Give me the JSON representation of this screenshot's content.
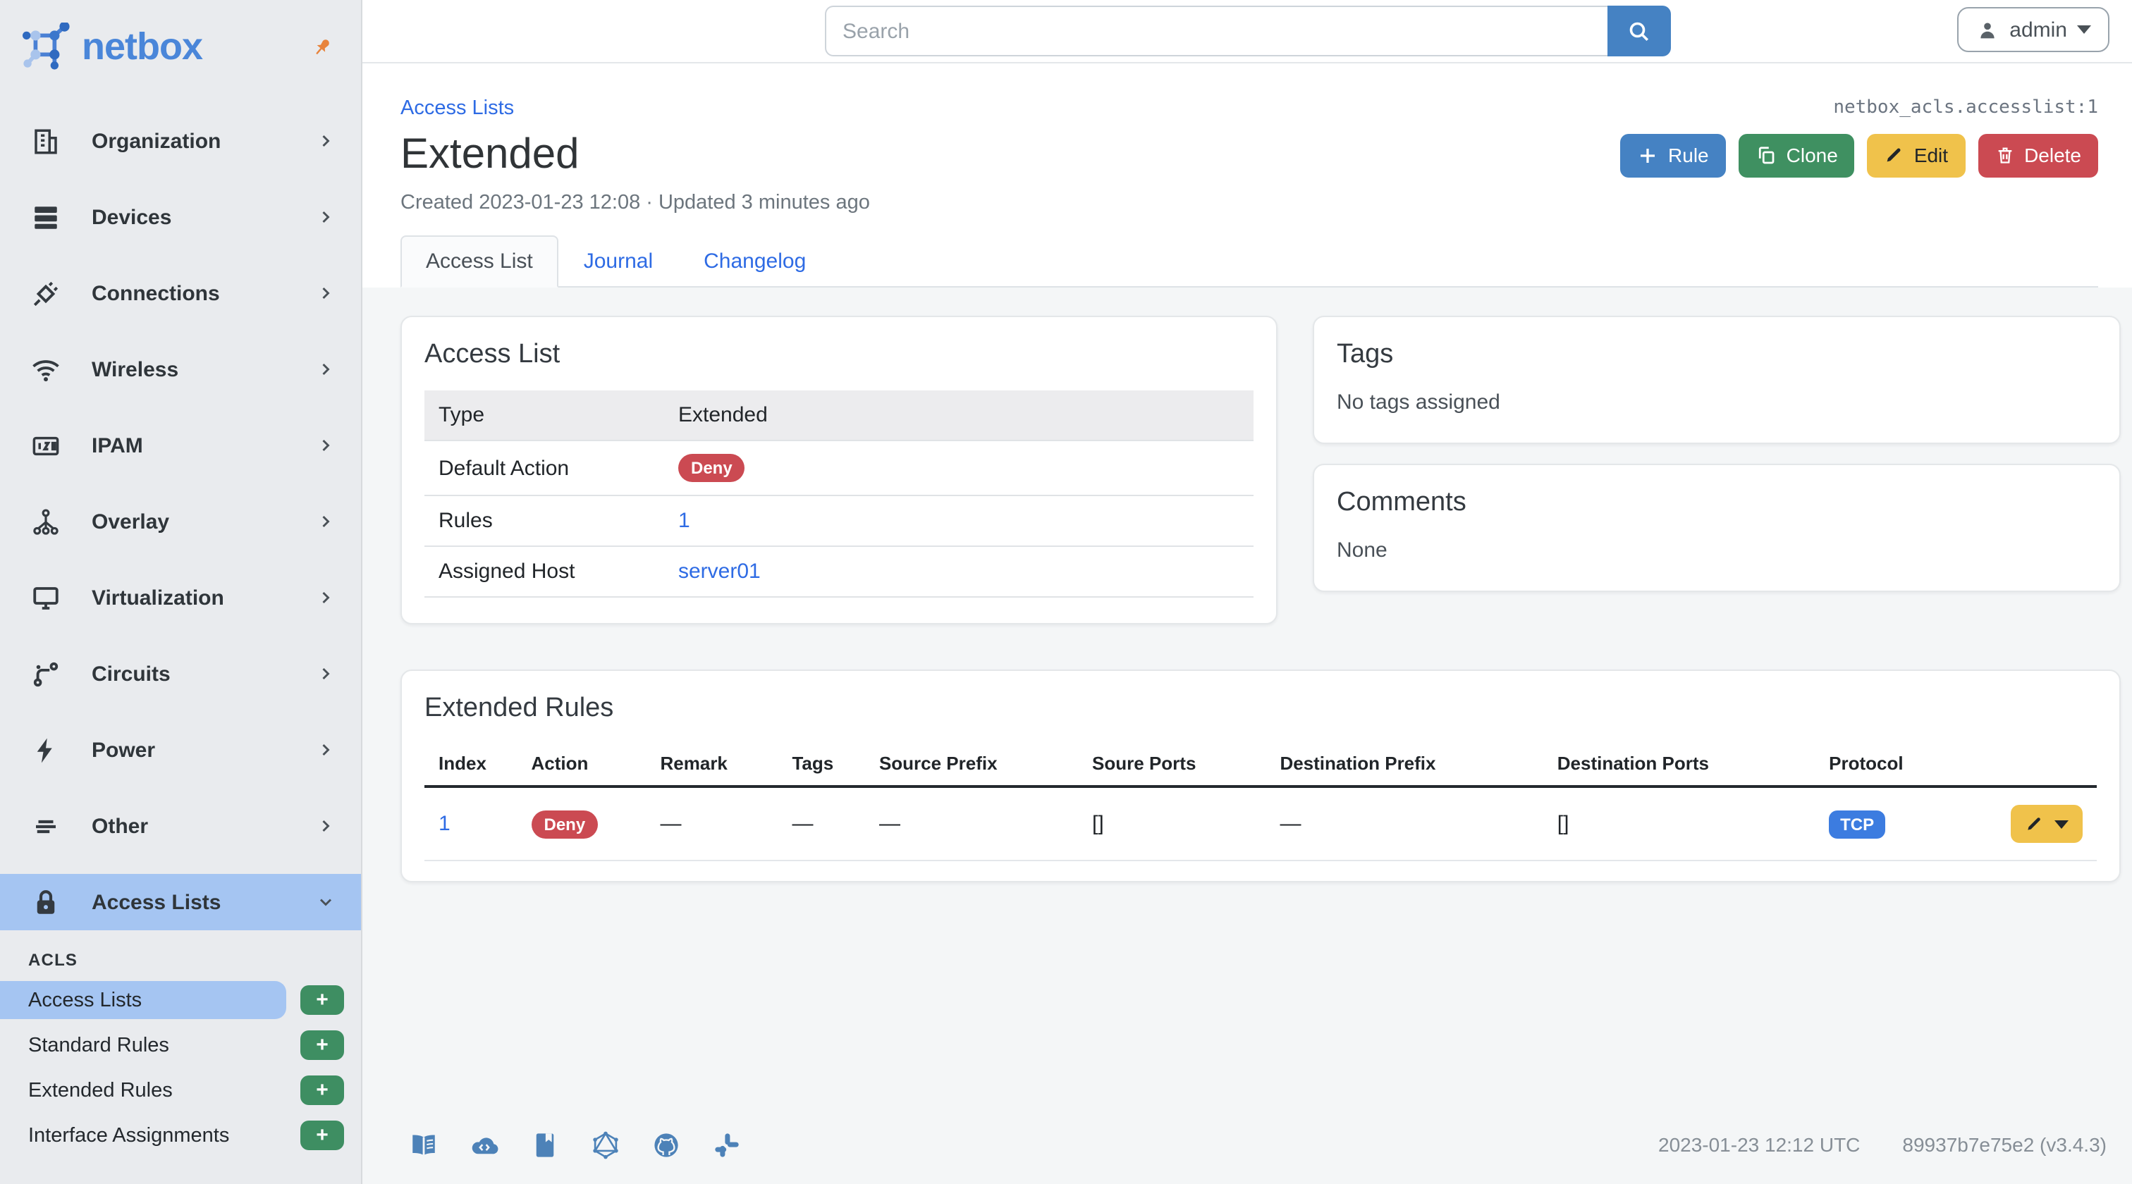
{
  "colors": {
    "primary_blue": "#4582c3",
    "link_blue": "#2e6be4",
    "nav_active_blue": "#a5c5f2",
    "green": "#3e8e62",
    "yellow": "#f0c24b",
    "red": "#cb4a52",
    "protocol_badge_blue": "#3c7ce0",
    "footer_icon_blue": "#4d82b8",
    "pin_orange": "#e8843c",
    "sidebar_bg": "#e9ebee",
    "content_bg": "#f4f6f7"
  },
  "sidebar": {
    "logo_text": "netbox",
    "items": [
      {
        "label": "Organization"
      },
      {
        "label": "Devices"
      },
      {
        "label": "Connections"
      },
      {
        "label": "Wireless"
      },
      {
        "label": "IPAM"
      },
      {
        "label": "Overlay"
      },
      {
        "label": "Virtualization"
      },
      {
        "label": "Circuits"
      },
      {
        "label": "Power"
      },
      {
        "label": "Other"
      },
      {
        "label": "Access Lists"
      }
    ],
    "acls_heading": "ACLS",
    "acls_items": [
      {
        "label": "Access Lists"
      },
      {
        "label": "Standard Rules"
      },
      {
        "label": "Extended Rules"
      },
      {
        "label": "Interface Assignments"
      }
    ],
    "add_button_label": "+"
  },
  "topbar": {
    "search_placeholder": "Search",
    "username": "admin"
  },
  "page": {
    "breadcrumb": "Access Lists",
    "object_id": "netbox_acls.accesslist:1",
    "title": "Extended",
    "meta": "Created 2023-01-23 12:08 · Updated 3 minutes ago",
    "actions": {
      "rule": "Rule",
      "clone": "Clone",
      "edit": "Edit",
      "delete": "Delete"
    }
  },
  "tabs": [
    {
      "label": "Access List"
    },
    {
      "label": "Journal"
    },
    {
      "label": "Changelog"
    }
  ],
  "access_list_panel": {
    "title": "Access List",
    "rows": [
      {
        "label": "Type",
        "value": "Extended"
      },
      {
        "label": "Default Action",
        "value": "Deny"
      },
      {
        "label": "Rules",
        "value": "1"
      },
      {
        "label": "Assigned Host",
        "value": "server01"
      }
    ]
  },
  "tags_panel": {
    "title": "Tags",
    "value": "No tags assigned"
  },
  "comments_panel": {
    "title": "Comments",
    "value": "None"
  },
  "rules_panel": {
    "title": "Extended Rules",
    "columns": [
      "Index",
      "Action",
      "Remark",
      "Tags",
      "Source Prefix",
      "Soure Ports",
      "Destination Prefix",
      "Destination Ports",
      "Protocol"
    ],
    "row": {
      "index": "1",
      "action": "Deny",
      "remark": "—",
      "tags": "—",
      "source_prefix": "—",
      "source_ports": "[]",
      "destination_prefix": "—",
      "destination_ports": "[]",
      "protocol": "TCP"
    }
  },
  "footer": {
    "timestamp": "2023-01-23 12:12 UTC",
    "version": "89937b7e75e2 (v3.4.3)"
  }
}
